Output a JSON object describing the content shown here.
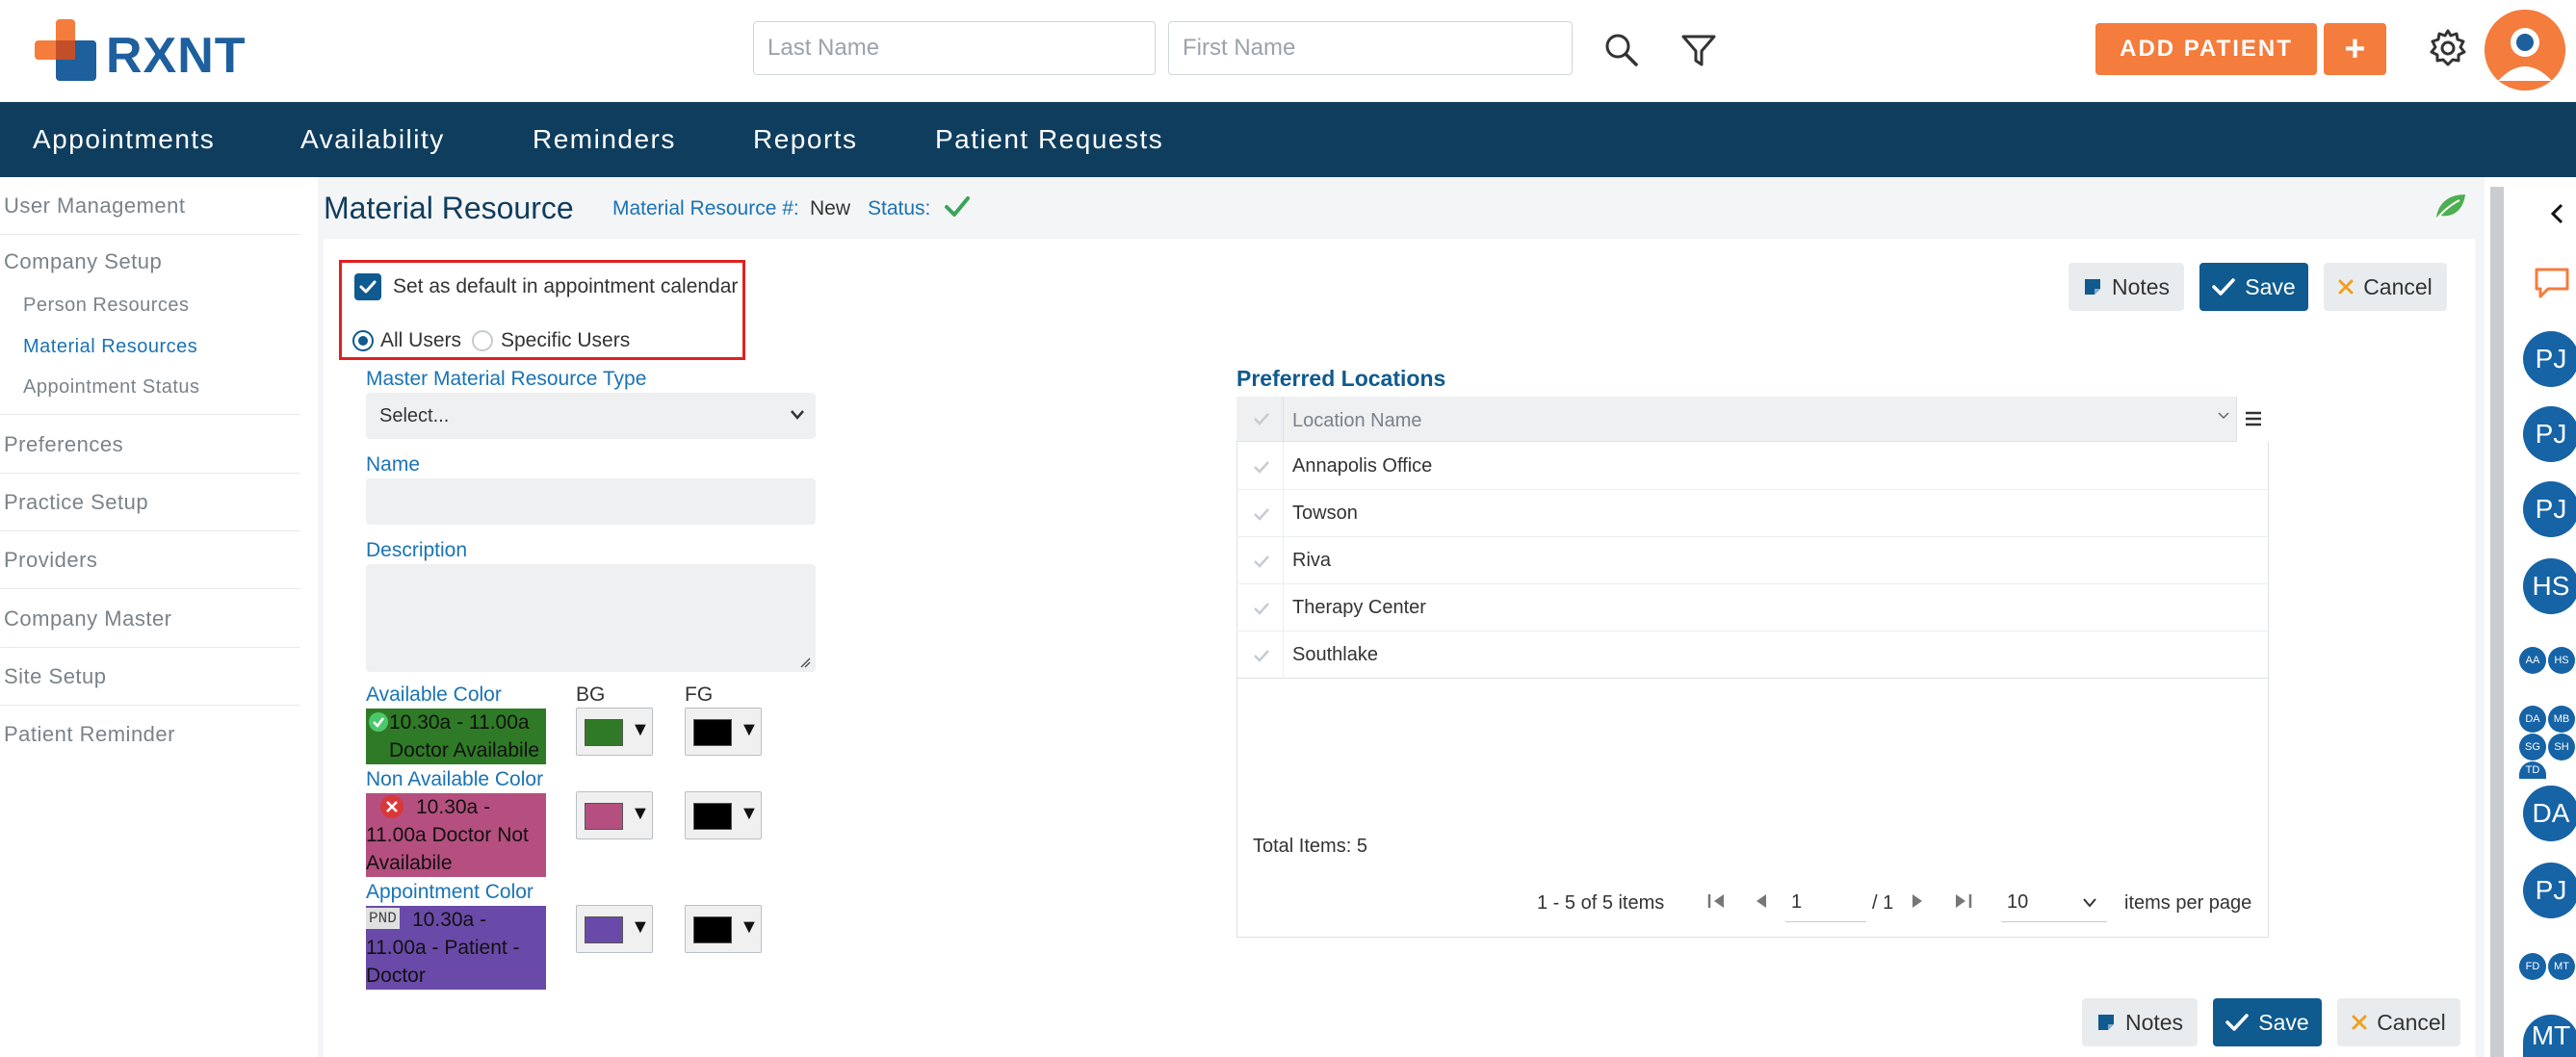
{
  "header": {
    "logo_text": "RXNT",
    "last_name_placeholder": "Last Name",
    "first_name_placeholder": "First Name",
    "add_patient_label": "ADD PATIENT",
    "add_plus_label": "+"
  },
  "nav": [
    "Appointments",
    "Availability",
    "Reminders",
    "Reports",
    "Patient Requests"
  ],
  "sidebar": {
    "user_management": "User Management",
    "company_setup": "Company Setup",
    "person_resources": "Person Resources",
    "material_resources": "Material Resources",
    "appointment_status": "Appointment Status",
    "preferences": "Preferences",
    "practice_setup": "Practice Setup",
    "providers": "Providers",
    "company_master": "Company Master",
    "site_setup": "Site Setup",
    "patient_reminder": "Patient Reminder"
  },
  "page": {
    "title": "Material Resource",
    "number_label": "Material Resource #:",
    "number_value": "New",
    "status_label": "Status:"
  },
  "buttons": {
    "notes": "Notes",
    "save": "Save",
    "cancel": "Cancel"
  },
  "form": {
    "default_calendar_label": "Set as default in appointment calendar",
    "all_users": "All Users",
    "specific_users": "Specific Users",
    "master_type_label": "Master Material Resource Type",
    "master_type_value": "Select...",
    "name_label": "Name",
    "description_label": "Description",
    "bg_label": "BG",
    "fg_label": "FG",
    "available_color_label": "Available Color",
    "available_preview": "10.30a - 11.00a Doctor Availabile",
    "available_bg": "#2f7a26",
    "available_fg": "#000000",
    "non_available_color_label": "Non Available Color",
    "non_available_preview": "10.30a - 11.00a Doctor Not Availabile",
    "non_available_bg": "#b54f7f",
    "non_available_fg": "#000000",
    "appointment_color_label": "Appointment Color",
    "appointment_badge": "PND",
    "appointment_preview": "10.30a - 11.00a - Patient - Doctor",
    "appointment_bg": "#6a4aa8",
    "appointment_fg": "#000000"
  },
  "locations": {
    "title": "Preferred Locations",
    "column": "Location Name",
    "rows": [
      "Annapolis Office",
      "Towson",
      "Riva",
      "Therapy Center",
      "Southlake"
    ],
    "total": "Total Items: 5",
    "range": "1 - 5 of 5 items",
    "page_value": "1",
    "page_total": "/ 1",
    "page_size": "10",
    "items_per_page": "items per page"
  },
  "rail": {
    "big": [
      "PJ",
      "PJ",
      "PJ",
      "HS",
      "DA",
      "PJ",
      "MT"
    ],
    "small": [
      "AA",
      "HS",
      "DA",
      "MB",
      "SG",
      "SH",
      "TD",
      "FD",
      "MT"
    ]
  },
  "colors": {
    "brand_navy": "#0f3d5e",
    "accent_orange": "#f47c3c",
    "primary_blue": "#0f5a8e",
    "link_blue": "#1a73b5"
  }
}
